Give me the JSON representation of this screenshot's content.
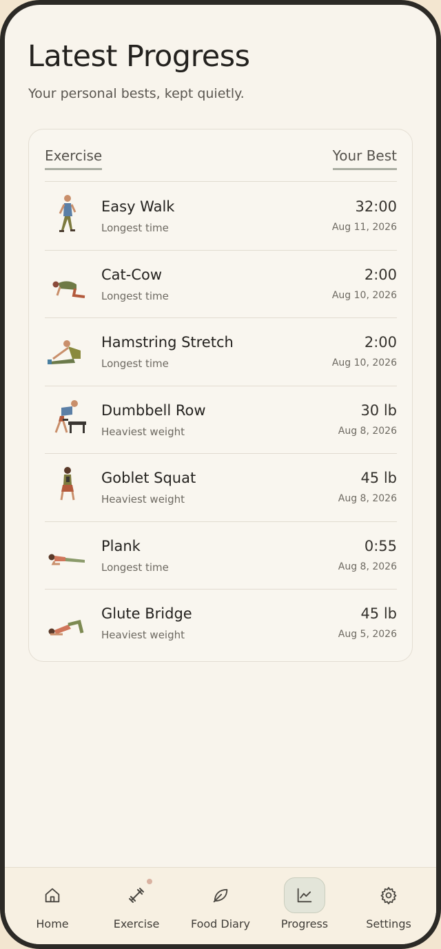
{
  "page": {
    "title": "Latest Progress",
    "subtitle": "Your personal bests, kept quietly."
  },
  "table": {
    "col_exercise": "Exercise",
    "col_best": "Your Best",
    "rows": [
      {
        "name": "Easy Walk",
        "metric": "Longest time",
        "value": "32:00",
        "date": "Aug 11, 2026",
        "icon": "walking-person-icon"
      },
      {
        "name": "Cat-Cow",
        "metric": "Longest time",
        "value": "2:00",
        "date": "Aug 10, 2026",
        "icon": "cat-cow-pose-icon"
      },
      {
        "name": "Hamstring Stretch",
        "metric": "Longest time",
        "value": "2:00",
        "date": "Aug 10, 2026",
        "icon": "hamstring-stretch-icon"
      },
      {
        "name": "Dumbbell Row",
        "metric": "Heaviest weight",
        "value": "30 lb",
        "date": "Aug 8, 2026",
        "icon": "dumbbell-row-icon"
      },
      {
        "name": "Goblet Squat",
        "metric": "Heaviest weight",
        "value": "45 lb",
        "date": "Aug 8, 2026",
        "icon": "goblet-squat-icon"
      },
      {
        "name": "Plank",
        "metric": "Longest time",
        "value": "0:55",
        "date": "Aug 8, 2026",
        "icon": "plank-icon"
      },
      {
        "name": "Glute Bridge",
        "metric": "Heaviest weight",
        "value": "45 lb",
        "date": "Aug 5, 2026",
        "icon": "glute-bridge-icon"
      }
    ]
  },
  "nav": {
    "items": [
      {
        "label": "Home",
        "icon": "home-icon"
      },
      {
        "label": "Exercise",
        "icon": "dumbbell-icon"
      },
      {
        "label": "Food Diary",
        "icon": "leaf-icon"
      },
      {
        "label": "Progress",
        "icon": "chart-line-icon"
      },
      {
        "label": "Settings",
        "icon": "gear-icon"
      }
    ],
    "active": "Progress"
  },
  "colors": {
    "background": "#f8f4ec",
    "accent": "#a9aca1",
    "active_nav": "#e3e5d9",
    "notification_dot": "#d9b2a1"
  }
}
